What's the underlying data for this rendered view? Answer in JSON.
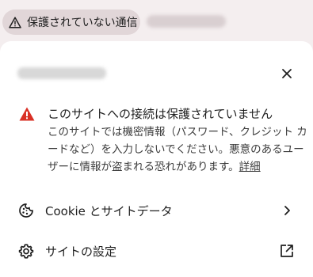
{
  "address_bar": {
    "security_chip_label": "保護されていない通信",
    "security_icon": "warning-triangle-icon"
  },
  "popup": {
    "close_icon": "close-icon",
    "warning": {
      "icon": "warning-triangle-icon",
      "icon_color": "#d93025",
      "title": "このサイトへの接続は保護されていません",
      "body": "このサイトでは機密情報（パスワード、クレジット カードなど）を入力しないでください。悪意のあるユーザーに情報が盗まれる恐れがあります。",
      "details_link": "詳細"
    },
    "cookie_row": {
      "label": "Cookie とサイトデータ",
      "icon": "cookie-icon",
      "trail_icon": "chevron-right-icon"
    },
    "settings_row": {
      "label": "サイトの設定",
      "icon": "gear-icon",
      "trail_icon": "open-in-new-icon"
    }
  }
}
